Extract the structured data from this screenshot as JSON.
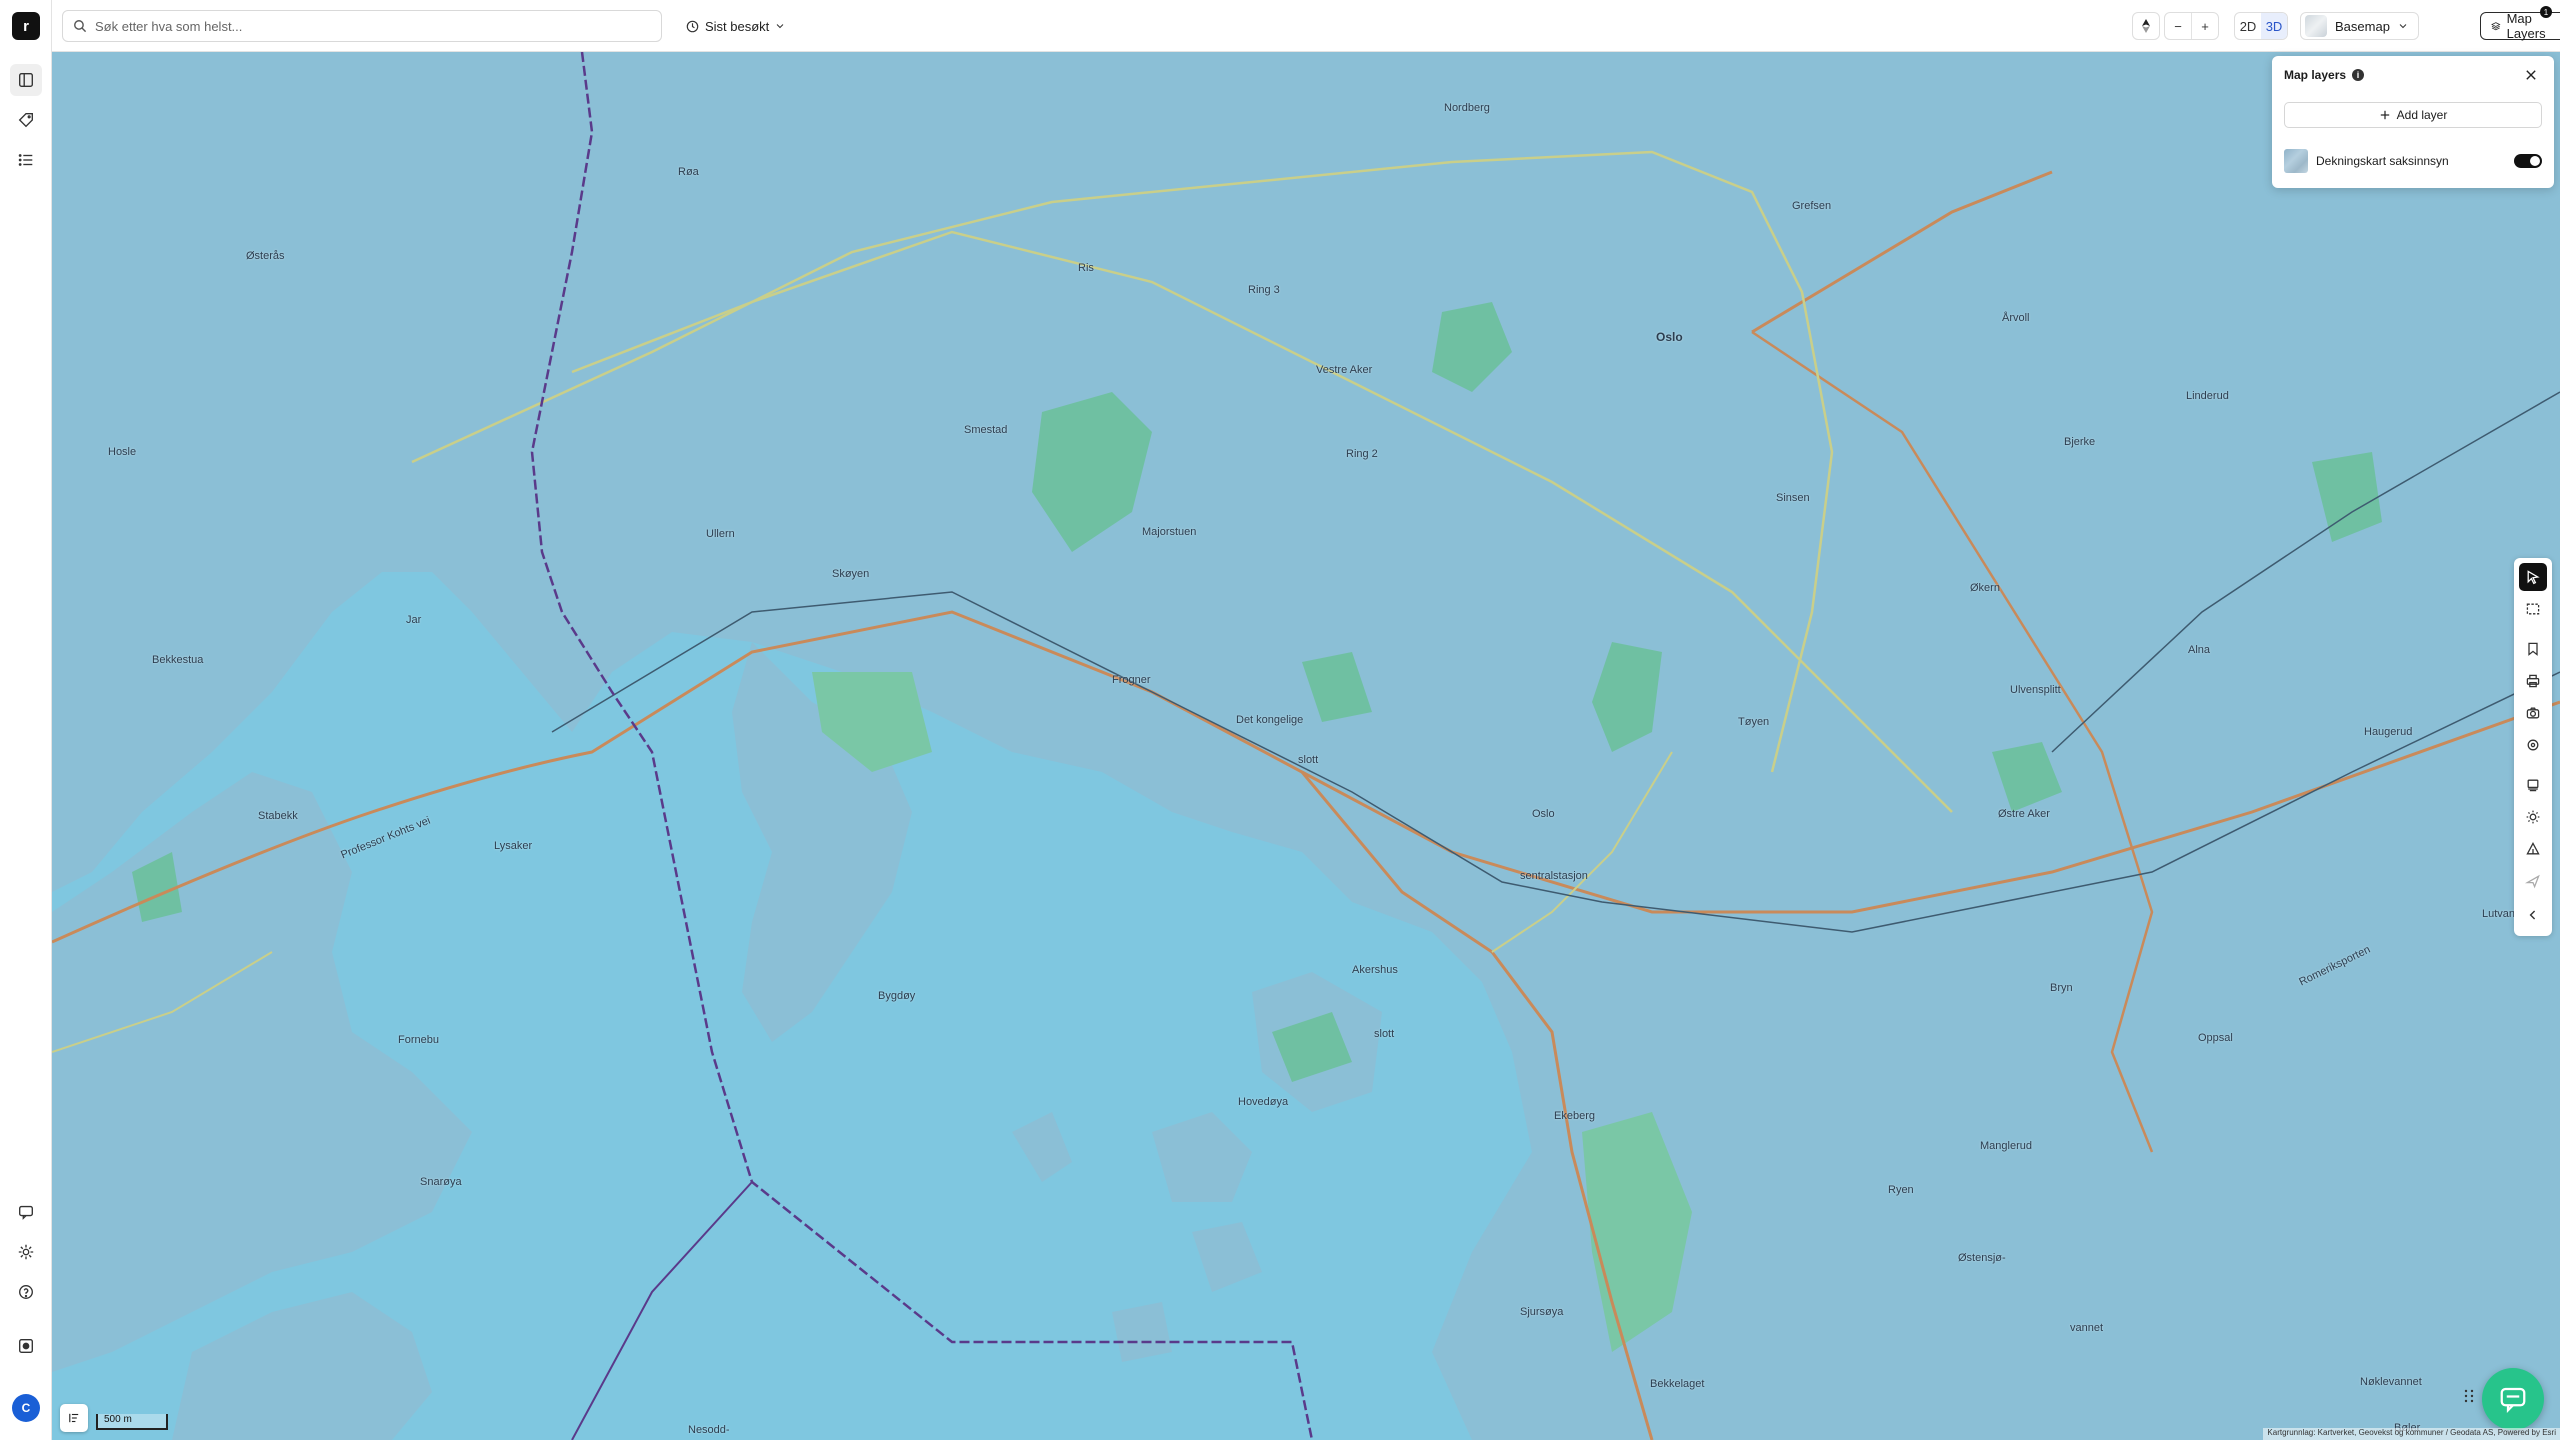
{
  "app": {
    "logo_letter": "r"
  },
  "search": {
    "placeholder": "Søk etter hva som helst..."
  },
  "recent": {
    "label": "Sist besøkt"
  },
  "view_mode": {
    "option_2d": "2D",
    "option_3d": "3D",
    "selected": "3D"
  },
  "zoom": {
    "out": "−",
    "in": "+"
  },
  "basemap": {
    "label": "Basemap"
  },
  "layers_button": {
    "label": "Map Layers",
    "badge": "1"
  },
  "layers_panel": {
    "title": "Map layers",
    "info": "i",
    "add_layer": "Add layer",
    "layers": [
      {
        "name": "Dekningskart saksinnsyn",
        "visible": true
      }
    ]
  },
  "user": {
    "initial": "C"
  },
  "scale_bar": {
    "label": "500 m"
  },
  "attribution": "Kartgrunnlag: Kartverket, Geovekst og kommuner / Geodata AS, Powered by Esri",
  "map_labels": [
    "Nordberg",
    "Røa",
    "Grefsen",
    "Østerås",
    "Ris",
    "Ring 3",
    "Oslo",
    "Vestre Aker",
    "Årvoll",
    "Linderud",
    "Smestad",
    "Bjerke",
    "Hosle",
    "Ring 2",
    "Sinsen",
    "Ullern",
    "Majorstuen",
    "Skøyen",
    "Jar",
    "Økern",
    "Bekkestua",
    "Frogner",
    "Alna",
    "Ulvensplitt",
    "Det kongelige",
    "Tøyen",
    "Haugerud",
    "slott",
    "Stabekk",
    "Lysaker",
    "Oslo",
    "Østre Aker",
    "sentralstasjon",
    "Lutvann",
    "Professor Kohts vei",
    "Akershus",
    "Bygdøy",
    "Bryn",
    "Romeriksporten",
    "slott",
    "Oppsal",
    "Fornebu",
    "Hovedøya",
    "Ekeberg",
    "Snarøya",
    "Manglerud",
    "Ryen",
    "Østensjø-",
    "vannet",
    "Sjursøya",
    "Nøklevannet",
    "Bekkelaget",
    "Nesodd-",
    "Bøler"
  ],
  "colors": {
    "map_water": "#7fc7e0",
    "map_land": "#8bbfd6",
    "map_green": "#6fc0a2",
    "road_major": "#c98a5a",
    "road_minor": "#c9cf8a",
    "boundary": "#5a3a8a",
    "chat_button": "#27c48b",
    "accent": "#2a55c9"
  }
}
